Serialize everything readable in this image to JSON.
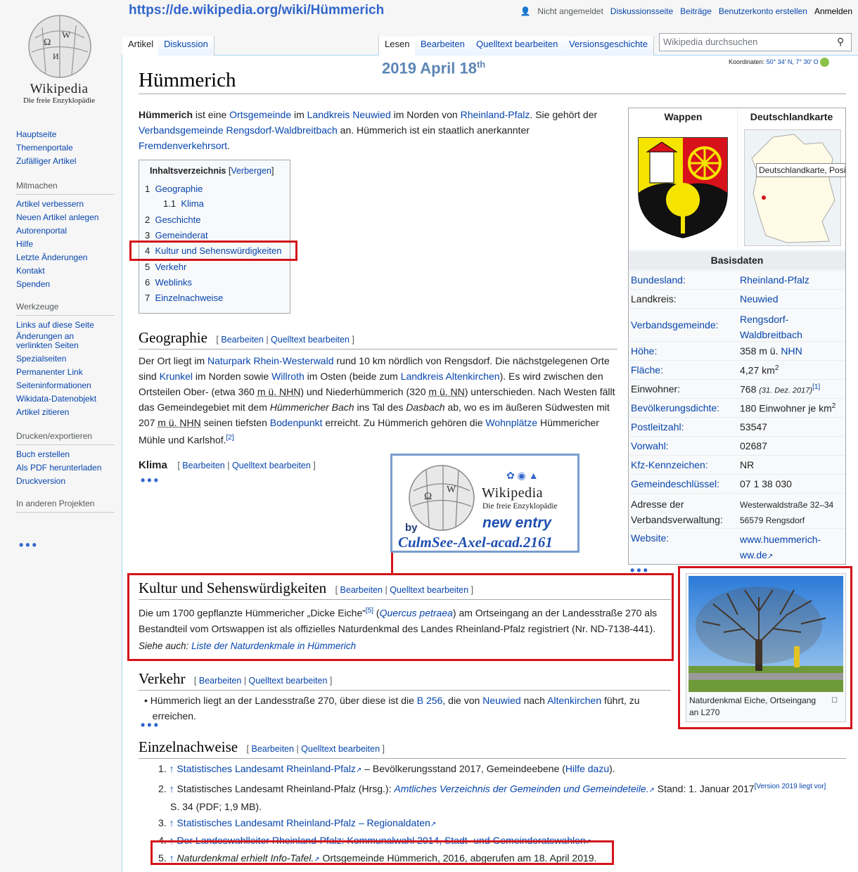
{
  "header": {
    "url": "https://de.wikipedia.org/wiki/Hümmerich",
    "date_text": "2019 April 18",
    "date_sup": "th"
  },
  "logo": {
    "title": "Wikipedia",
    "subtitle": "Die freie Enzyklopädie"
  },
  "personal": {
    "not_logged": "Nicht angemeldet",
    "talk": "Diskussionsseite",
    "contrib": "Beiträge",
    "create": "Benutzerkonto erstellen",
    "login": "Anmelden"
  },
  "tabs": {
    "article": "Artikel",
    "discussion": "Diskussion",
    "read": "Lesen",
    "edit": "Bearbeiten",
    "source": "Quelltext bearbeiten",
    "history": "Versionsgeschichte"
  },
  "search": {
    "placeholder": "Wikipedia durchsuchen"
  },
  "coords": {
    "label": "Koordinaten:",
    "value": "50° 34′ N, 7° 30′ O"
  },
  "sidebar": {
    "main": [
      "Hauptseite",
      "Themenportale",
      "Zufälliger Artikel"
    ],
    "mitmachen_head": "Mitmachen",
    "mitmachen": [
      "Artikel verbessern",
      "Neuen Artikel anlegen",
      "Autorenportal",
      "Hilfe",
      "Letzte Änderungen",
      "Kontakt",
      "Spenden"
    ],
    "werkzeuge_head": "Werkzeuge",
    "werkzeuge": [
      "Links auf diese Seite",
      "Änderungen an",
      "verlinkten Seiten",
      "Spezialseiten",
      "Permanenter Link",
      "Seiteninformationen",
      "Wikidata-Datenobjekt",
      "Artikel zitieren"
    ],
    "drucken_head": "Drucken/exportieren",
    "drucken": [
      "Buch erstellen",
      "Als PDF herunterladen",
      "Druckversion"
    ],
    "projekte_head": "In anderen Projekten"
  },
  "title": "Hümmerich",
  "intro": {
    "b": "Hümmerich",
    "t1": " ist eine ",
    "l1": "Ortsgemeinde",
    "t2": " im ",
    "l2": "Landkreis Neuwied",
    "t3": " im Norden von ",
    "l3": "Rheinland-Pfalz",
    "t4": ". Sie gehört der",
    "l4": "Verbandsgemeinde Rengsdorf-Waldbreitbach",
    "t5": " an. Hümmerich ist ein staatlich anerkannter",
    "l5": "Fremdenverkehrsort",
    "t6": "."
  },
  "toc": {
    "title": "Inhaltsverzeichnis",
    "hide": "Verbergen",
    "items": [
      {
        "n": "1",
        "t": "Geographie"
      },
      {
        "n": "1.1",
        "t": "Klima"
      },
      {
        "n": "2",
        "t": "Geschichte"
      },
      {
        "n": "3",
        "t": "Gemeinderat"
      },
      {
        "n": "4",
        "t": "Kultur und Sehenswürdigkeiten"
      },
      {
        "n": "5",
        "t": "Verkehr"
      },
      {
        "n": "6",
        "t": "Weblinks"
      },
      {
        "n": "7",
        "t": "Einzelnachweise"
      }
    ]
  },
  "edit": {
    "edit": "Bearbeiten",
    "source": "Quelltext bearbeiten"
  },
  "geo": {
    "h": "Geographie",
    "l1a": "Der Ort liegt im ",
    "l1b": "Naturpark Rhein-Westerwald",
    "l1c": " rund 10 km nördlich von Rengsdorf. Die nächstgelegenen Orte",
    "l2a": "sind ",
    "l2b": "Krunkel",
    "l2c": " im Norden sowie ",
    "l2d": "Willroth",
    "l2e": " im Osten (beide zum ",
    "l2f": "Landkreis Altenkirchen",
    "l2g": "). Es wird zwischen den",
    "l3a": "Ortsteilen Ober- (etwa 360 ",
    "l3b": "m ü. NHN",
    "l3c": ") und Niederhümmerich (320 ",
    "l3d": "m ü. NN",
    "l3e": ") unterschieden. Nach Westen fällt",
    "l4a": "das Gemeindegebiet mit dem ",
    "l4b": "Hümmericher Bach",
    "l4c": " ins Tal des ",
    "l4d": "Dasbach",
    "l4e": " ab, wo es im äußeren Südwesten mit",
    "l5a": "207 ",
    "l5b": "m ü. NHN",
    "l5c": " seinen tiefsten ",
    "l5d": "Bodenpunkt",
    "l5e": " erreicht. Zu Hümmerich gehören die ",
    "l5f": "Wohnplätze",
    "l5g": " Hümmericher",
    "l6a": "Mühle und Karlshof.",
    "l6b": "[2]"
  },
  "klima": {
    "h": "Klima"
  },
  "stamp": {
    "title": "Wikipedia",
    "subtitle": "Die freie Enzyklopädie",
    "by": "by",
    "new": "new entry",
    "author": "CulmSee-Axel-acad.2161"
  },
  "kultur": {
    "h": "Kultur und Sehenswürdigkeiten",
    "l1a": "Die um 1700 gepflanzte Hümmericher „Dicke Eiche“",
    "l1b": "[5]",
    "l1c": " (",
    "l1d": "Quercus petraea",
    "l1e": ") am Ortseingang an der Landesstraße 270 als",
    "l2": "Bestandteil vom Ortswappen ist als offizielles Naturdenkmal des Landes Rheinland-Pfalz registriert (Nr. ND-7138-441).",
    "see_a": "Siehe auch: ",
    "see_b": "Liste der Naturdenkmale in Hümmerich"
  },
  "verkehr": {
    "h": "Verkehr",
    "l1a": "Hümmerich liegt an der Landesstraße 270, über diese ist die ",
    "l1b": "B 256",
    "l1c": ", die von ",
    "l1d": "Neuwied",
    "l1e": " nach ",
    "l1f": "Altenkirchen",
    "l1g": " führt, zu",
    "l2": "erreichen."
  },
  "refs": {
    "h": "Einzelnachweise",
    "items": [
      {
        "n": "1.",
        "a": "Statistisches Landesamt Rheinland-Pfalz",
        "b": " – Bevölkerungsstand 2017, Gemeindeebene (",
        "c": "Hilfe dazu",
        "d": ")."
      },
      {
        "n": "2.",
        "a": "Statistisches Landesamt Rheinland-Pfalz (Hrsg.): ",
        "b": "Amtliches Verzeichnis der Gemeinden und Gemeindeteile.",
        "c": " Stand: 1. Januar 2017",
        "d": "[Version 2019 liegt vor]",
        "e": "S. 34 (PDF; 1,9 MB)."
      },
      {
        "n": "3.",
        "a": "Statistisches Landesamt Rheinland-Pfalz – Regionaldaten"
      },
      {
        "n": "4.",
        "a": "Der Landeswahlleiter Rheinland-Pfalz: Kommunalwahl 2014, Stadt- und Gemeinderatswahlen"
      },
      {
        "n": "5.",
        "a": "Naturdenkmal erhielt Info-Tafel.",
        "b": " Ortsgemeinde Hümmerich, 2016, abgerufen am 18. April 2019."
      }
    ]
  },
  "infobox": {
    "wappen": "Wappen",
    "karte": "Deutschlandkarte",
    "tooltip": "Deutschlandkarte, Position",
    "basis": "Basisdaten",
    "rows": [
      {
        "k": "Bundesland:",
        "v": "Rheinland-Pfalz"
      },
      {
        "k": "Landkreis:",
        "v": "Neuwied"
      },
      {
        "k": "Verbandsgemeinde:",
        "v": "Rengsdorf-",
        "v2": "Waldbreitbach"
      },
      {
        "k": "Höhe:",
        "v": "358 m ü. ",
        "v2": "NHN"
      },
      {
        "k": "Fläche:",
        "v": "4,27 km",
        "sup": "2"
      },
      {
        "k": "Einwohner:",
        "v": "768 ",
        "it": "(31. Dez. 2017)",
        "sup": "[1]"
      },
      {
        "k": "Bevölkerungsdichte:",
        "v": "180 Einwohner je km",
        "sup": "2"
      },
      {
        "k": "Postleitzahl:",
        "v": "53547"
      },
      {
        "k": "Vorwahl:",
        "v": "02687"
      },
      {
        "k": "Kfz-Kennzeichen:",
        "v": "NR"
      },
      {
        "k": "Gemeindeschlüssel:",
        "v": "07 1 38 030"
      },
      {
        "k": "Adresse der",
        "k2": "Verbandsverwaltung:",
        "v": "Westerwaldstraße 32–34",
        "v2": "56579 Rengsdorf"
      },
      {
        "k": "Website:",
        "v": "www.huemmerich-",
        "v2": "ww.de"
      }
    ]
  },
  "photo": {
    "caption1": "Naturdenkmal Eiche, Ortseingang",
    "caption2": "an L270"
  },
  "colors": {
    "link": "#0645ad",
    "red": "#d3141a",
    "stampBlue": "#5b86b5"
  }
}
